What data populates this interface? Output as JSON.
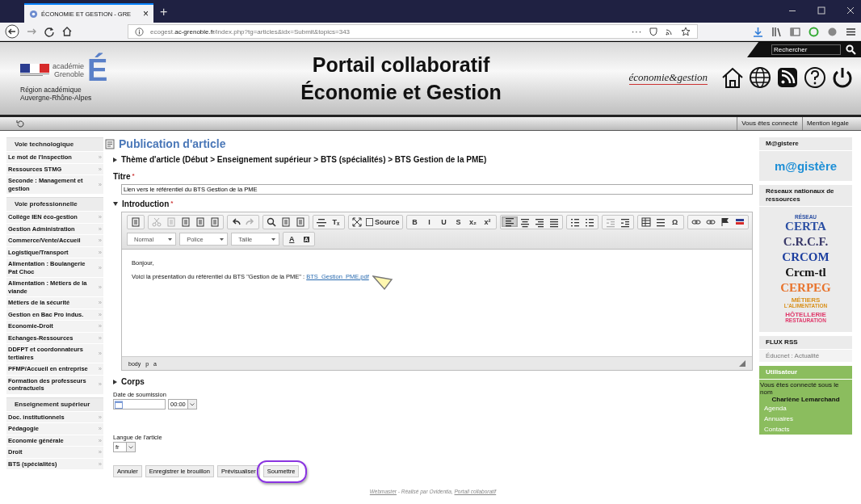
{
  "browser": {
    "tab_title": "ÉCONOMIE ET GESTION - GRE",
    "tab_close": "×",
    "new_tab": "+",
    "url": "ecogest.**ac-grenoble.fr**/index.php?tg=articles&idx=Submit&topics=343",
    "more": "···"
  },
  "header": {
    "academie": "académie",
    "city": "Grenoble",
    "letter": "É",
    "region": "Région académique",
    "area": "Auvergne-Rhône-Alpes",
    "title_lines": [
      "Portail collaboratif",
      "Économie et Gestion"
    ],
    "partner_logo": "économie&gestion",
    "search": {
      "placeholder": "Rechercher"
    }
  },
  "item_arrow": "»",
  "top_links": [
    "Vous êtes connecté",
    "Mention légale"
  ],
  "left_sidebar": [
    {
      "title": "Voie technologique",
      "items": [
        "Le mot de l'Inspection",
        "Ressources STMG",
        "Seconde : Management et gestion"
      ]
    },
    {
      "title": "Voie professionnelle",
      "items": [
        "Collège IEN éco-gestion",
        "Gestion Administration",
        "Commerce/Vente/Accueil",
        "Logistique/Transport",
        "Alimentation : Boulangerie Pat Choc",
        "Alimentation : Métiers de la viande",
        "Métiers de la sécurité",
        "Gestion en Bac Pro indus.",
        "Economie-Droit",
        "Echanges-Ressources",
        "DDFPT et coordonnateurs tertiaires",
        "PFMP/Accueil en entreprise",
        "Formation des professeurs contractuels"
      ]
    },
    {
      "title": "Enseignement supérieur",
      "items": [
        "Doc. institutionnels",
        "Pédagogie",
        "Economie générale",
        "Droit",
        "BTS (spécialités)"
      ]
    }
  ],
  "article": {
    "heading": "Publication d'article",
    "theme": "Thème d'article (Début > Enseignement supérieur > BTS (spécialités) > BTS Gestion de la PME)",
    "title_label": "Titre",
    "title_value": "Lien vers le référentiel du BTS Gestion de la PME",
    "intro_label": "Introduction",
    "required_mark": "*",
    "editor": {
      "toolbar": [
        [
          {
            "kind": "doc",
            "disabled": false
          }
        ],
        [
          {
            "kind": "cut",
            "disabled": true
          },
          {
            "kind": "copy",
            "disabled": true
          },
          {
            "kind": "paste",
            "disabled": false
          },
          {
            "kind": "paste",
            "disabled": false
          },
          {
            "kind": "paste",
            "disabled": false
          }
        ],
        [
          {
            "kind": "undo",
            "disabled": false
          },
          {
            "kind": "redo",
            "disabled": true
          }
        ],
        [
          {
            "kind": "search",
            "disabled": false
          },
          {
            "kind": "replace",
            "disabled": false
          },
          {
            "kind": "spell",
            "disabled": false
          }
        ],
        [
          {
            "kind": "pagebreak",
            "disabled": false
          },
          {
            "kind": "text",
            "glyph": "Tₓ",
            "disabled": false
          }
        ],
        [
          {
            "kind": "maximize",
            "disabled": false
          },
          {
            "kind": "source",
            "label": "Source",
            "disabled": false
          }
        ],
        [
          {
            "kind": "text",
            "glyph": "B",
            "disabled": false
          },
          {
            "kind": "text",
            "glyph": "I",
            "disabled": false
          },
          {
            "kind": "text",
            "glyph": "U",
            "disabled": false
          },
          {
            "kind": "text",
            "glyph": "S",
            "disabled": false
          },
          {
            "kind": "text",
            "glyph": "x₂",
            "disabled": false
          },
          {
            "kind": "text",
            "glyph": "x²",
            "disabled": false
          }
        ],
        [
          {
            "kind": "align-left",
            "disabled": false,
            "selected": true
          },
          {
            "kind": "align-center",
            "disabled": false,
            "selected": false
          },
          {
            "kind": "align-right",
            "disabled": false,
            "selected": false
          },
          {
            "kind": "align-justify",
            "disabled": false,
            "selected": false
          }
        ],
        [
          {
            "kind": "list-num",
            "disabled": false
          },
          {
            "kind": "list-bullet",
            "disabled": false
          }
        ],
        [
          {
            "kind": "outdent",
            "disabled": true
          },
          {
            "kind": "indent",
            "disabled": false
          }
        ],
        [
          {
            "kind": "table",
            "disabled": false
          },
          {
            "kind": "hr",
            "disabled": false
          },
          {
            "kind": "text",
            "glyph": "Ω",
            "disabled": false
          }
        ],
        [
          {
            "kind": "link",
            "disabled": false
          },
          {
            "kind": "unlink",
            "disabled": false
          },
          {
            "kind": "flag",
            "disabled": false
          },
          {
            "kind": "lang",
            "disabled": false
          }
        ]
      ],
      "combos": [
        "Normal",
        "Police",
        "Taille"
      ],
      "color_buttons": [
        "A",
        "A"
      ],
      "greeting": "Bonjour,",
      "sentence": "Voici la présentation du référentiel du BTS \"Gestion de la PME\" : ",
      "link": "BTS_Gestion_PME.pdf",
      "path": [
        "body",
        "p",
        "a"
      ]
    },
    "body_label": "Corps",
    "date_label": "Date de soumission",
    "time_value": "00:00",
    "lang_label": "Langue de l'article",
    "lang_value": "fr",
    "buttons": [
      {
        "label": "Annuler",
        "highlighted": false
      },
      {
        "label": "Enregistrer le brouillon",
        "highlighted": false
      },
      {
        "label": "Prévisualiser",
        "highlighted": false
      },
      {
        "label": "Soumettre",
        "highlighted": true
      }
    ]
  },
  "right_sidebar": [
    {
      "kind": "logo",
      "title": "M@gistere",
      "logo": "m@gistère"
    },
    {
      "kind": "logos",
      "title": "Réseaux nationaux de ressources",
      "logos": [
        {
          "lines": [
            "RÉSEAU",
            "CERTA"
          ],
          "color": "#2b4fa3"
        },
        {
          "lines": [
            "C.R.C.F."
          ],
          "color": "#3a3a6a"
        },
        {
          "lines": [
            "CRCOM"
          ],
          "color": "#1d3f9f"
        },
        {
          "lines": [
            "Crcm-tl"
          ],
          "color": "#111111"
        },
        {
          "lines": [
            "CERPEG"
          ],
          "color": "#e8732c"
        },
        {
          "lines": [
            "MÉTIERS",
            "L'ALIMENTATION"
          ],
          "color": "#d9901a"
        },
        {
          "lines": [
            "HÔTELLERIE",
            "RESTAURATION"
          ],
          "color": "#e0386a"
        }
      ]
    },
    {
      "kind": "links",
      "title": "FLUX RSS",
      "links": [
        "Éducnet : Actualité"
      ]
    },
    {
      "kind": "user",
      "title": "Utilisateur",
      "text": "Vous êtes connecté sous le nom",
      "name": "Charlène Lemarchand",
      "links": [
        "Agenda",
        "Annuaires",
        "Contacts"
      ]
    }
  ],
  "footer": {
    "link1": "Webmaster",
    "middle": " - Réalisé par Ovidentia, ",
    "link2": "Portail collaboratif"
  }
}
